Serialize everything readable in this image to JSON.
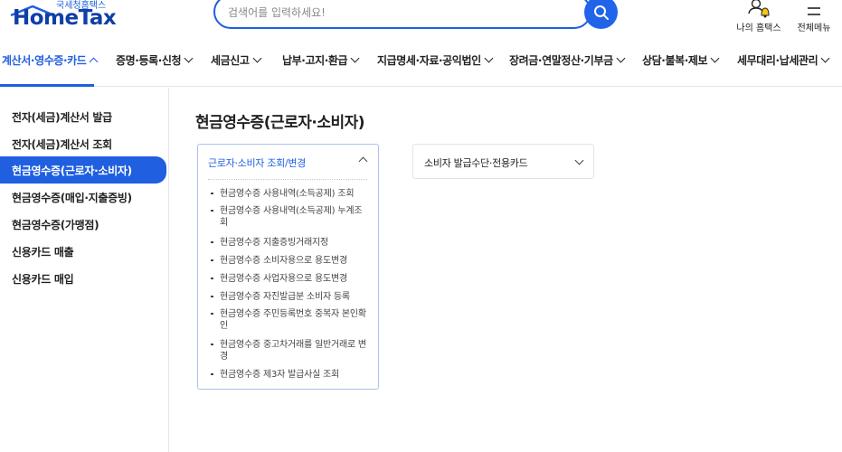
{
  "logo": {
    "sub": "국세청홈택스",
    "main": "HomeTax"
  },
  "search": {
    "placeholder": "검색어를 입력하세요!",
    "value": ""
  },
  "util": {
    "my_hometax": "나의 홈택스",
    "all_menu": "전체메뉴"
  },
  "nav": [
    {
      "label": "계산서·영수증·카드",
      "active": true
    },
    {
      "label": "증명·등록·신청"
    },
    {
      "label": "세금신고"
    },
    {
      "label": "납부·고지·환급"
    },
    {
      "label": "지급명세·자료·공익법인"
    },
    {
      "label": "장려금·연말정산·기부금"
    },
    {
      "label": "상담·불복·제보"
    },
    {
      "label": "세무대리·납세관리"
    }
  ],
  "sidebar": {
    "items": [
      {
        "label": "전자(세금)계산서 발급"
      },
      {
        "label": "전자(세금)계산서 조회"
      },
      {
        "label": "현금영수증(근로자·소비자)",
        "active": true
      },
      {
        "label": "현금영수증(매입·지출증빙)"
      },
      {
        "label": "현금영수증(가맹점)"
      },
      {
        "label": "신용카드 매출"
      },
      {
        "label": "신용카드 매입"
      }
    ]
  },
  "main": {
    "title": "현금영수증(근로자·소비자)",
    "card1": {
      "header": "근로자·소비자 조회/변경",
      "items": [
        "현금영수증 사용내역(소득공제) 조회",
        "현금영수증 사용내역(소득공제) 누계조회",
        "현금영수증 지출증빙거래지정",
        "현금영수증 소비자용으로 용도변경",
        "현금영수증 사업자용으로 용도변경",
        "현금영수증 자진발급분 소비자 등록",
        "현금영수증 주민등록번호 중복자 본인확인",
        "현금영수증 중고차거래를 일반거래로 변경",
        "현금영수증 제3자 발급사실 조회"
      ]
    },
    "card2": {
      "header": "소비자 발급수단·전용카드"
    }
  },
  "colors": {
    "accent": "#1f5fe0",
    "logo": "#0f3fa8",
    "border": "#a9c1ee"
  },
  "icons": {
    "search": "search-icon",
    "my": "user-bell-icon",
    "menu": "hamburger-icon"
  }
}
